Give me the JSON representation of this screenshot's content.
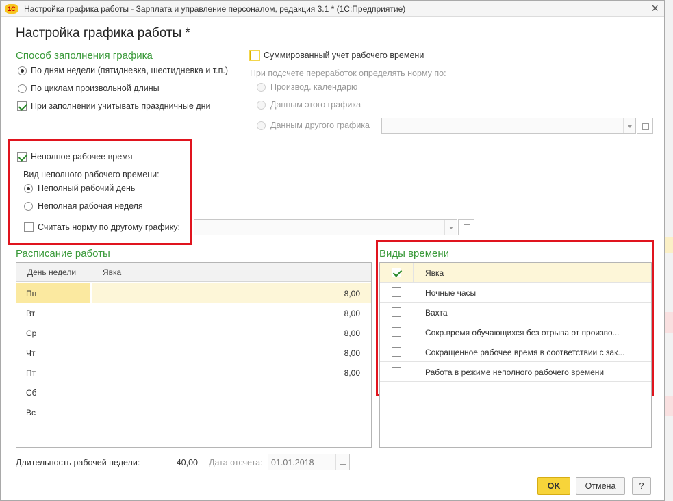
{
  "window": {
    "title": "Настройка графика работы - Зарплата и управление персоналом, редакция 3.1 * (1С:Предприятие)",
    "logo_text": "1С",
    "close_glyph": "×"
  },
  "form": {
    "title": "Настройка графика работы *"
  },
  "fill_method": {
    "heading": "Способ заполнения графика",
    "by_weekdays": "По дням недели (пятидневка, шестидневка и т.п.)",
    "by_cycles": "По циклам произвольной длины",
    "holidays": "При заполнении учитывать праздничные дни"
  },
  "summarized": {
    "label": "Суммированный учет рабочего времени",
    "norm_caption": "При подсчете переработок определять норму по:",
    "opt_calendar": "Производ. календарю",
    "opt_this": "Данным этого графика",
    "opt_other": "Данным другого графика"
  },
  "part_time": {
    "label": "Неполное рабочее время",
    "kind_caption": "Вид неполного рабочего времени:",
    "opt_day": "Неполный рабочий день",
    "opt_week": "Неполная рабочая неделя",
    "other_norm": "Считать норму по другому графику:"
  },
  "schedule": {
    "heading": "Расписание работы",
    "col_day": "День недели",
    "col_value": "Явка",
    "rows": [
      {
        "day": "Пн",
        "value": "8,00"
      },
      {
        "day": "Вт",
        "value": "8,00"
      },
      {
        "day": "Ср",
        "value": "8,00"
      },
      {
        "day": "Чт",
        "value": "8,00"
      },
      {
        "day": "Пт",
        "value": "8,00"
      },
      {
        "day": "Сб",
        "value": ""
      },
      {
        "day": "Вс",
        "value": ""
      }
    ]
  },
  "time_types": {
    "heading": "Виды времени",
    "items": [
      {
        "label": "Явка",
        "checked": true
      },
      {
        "label": "Ночные часы",
        "checked": false
      },
      {
        "label": "Вахта",
        "checked": false
      },
      {
        "label": "Сокр.время обучающихся без отрыва от произво...",
        "checked": false
      },
      {
        "label": "Сокращенное рабочее время в соответствии с зак...",
        "checked": false
      },
      {
        "label": "Работа в режиме неполного рабочего времени",
        "checked": false
      }
    ]
  },
  "footer": {
    "week_length_label": "Длительность рабочей недели:",
    "week_length_value": "40,00",
    "date_label": "Дата отсчета:",
    "date_value": "01.01.2018",
    "ok": "OK",
    "cancel": "Отмена",
    "help": "?"
  },
  "colors": {
    "section_heading": "#3a9a3a",
    "highlight_box": "#e0141e",
    "ok_button": "#f7d43a",
    "selection": "#fbe9a0"
  }
}
